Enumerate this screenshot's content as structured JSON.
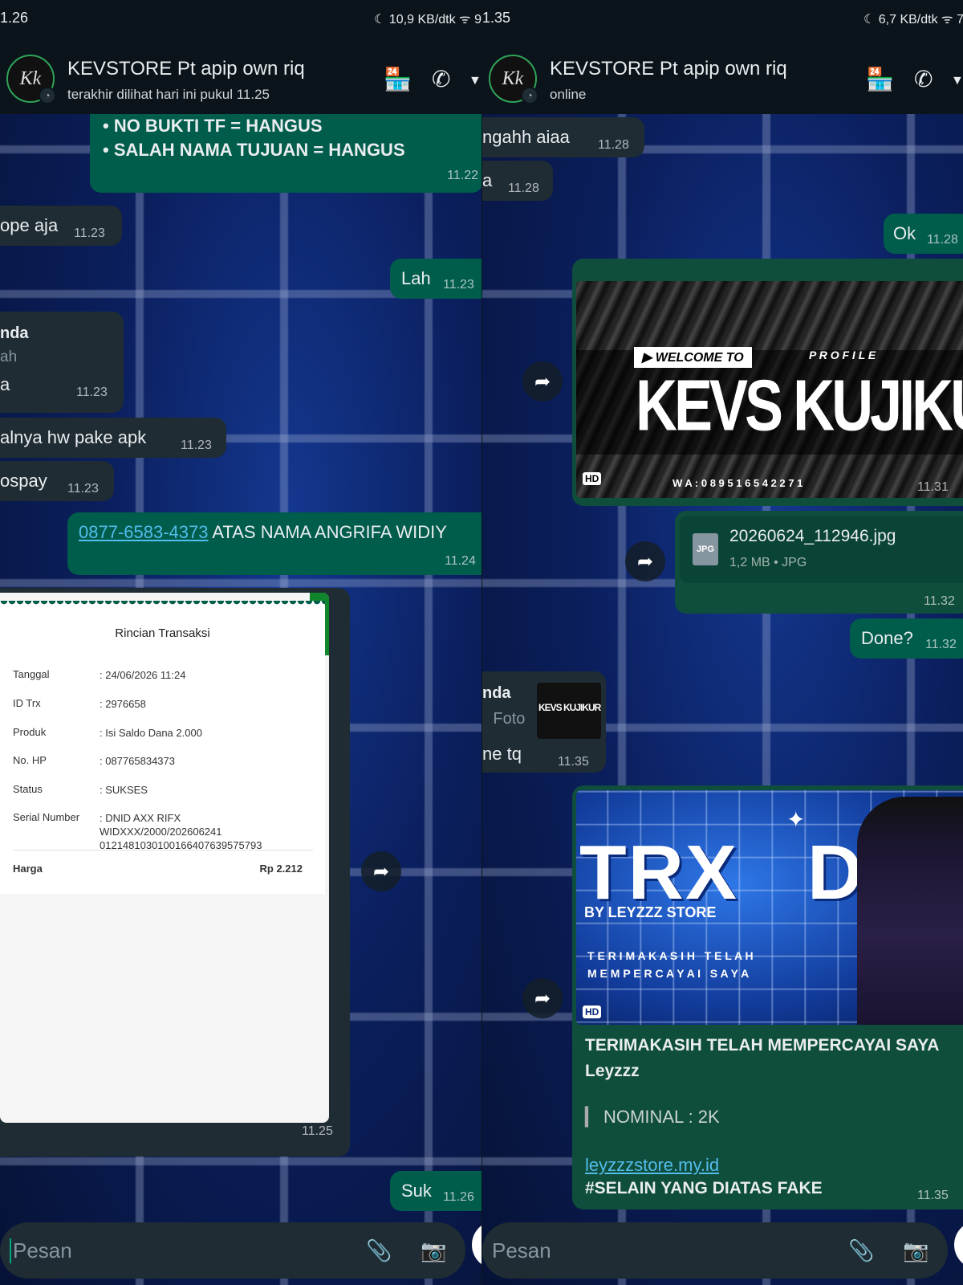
{
  "left": {
    "status_time": "1.26",
    "status_icons": "☾ 10,9 KB/dtk ᯤ 9",
    "contact_name": "KEVSTORE Pt apip own riq",
    "contact_sub": "terakhir dilihat hari ini pukul 11.25",
    "msg_rules_1": "• NO BUKTI TF = HANGUS",
    "msg_rules_2": "• SALAH NAMA TUJUAN = HANGUS",
    "msg_rules_ts": "11.22",
    "msg_in1_text": "ope aja",
    "msg_in1_ts": "11.23",
    "msg_out_lah": "Lah",
    "msg_out_lah_ts": "11.23",
    "msg_in2_line1": "nda",
    "msg_in2_line2": "ah",
    "msg_in2_line3": "a",
    "msg_in2_ts": "11.23",
    "msg_in3_text": "alnya hw pake apk",
    "msg_in3_ts": "11.23",
    "msg_in4_text": "ospay",
    "msg_in4_ts": "11.23",
    "msg_out_phone_link": "0877-6583-4373",
    "msg_out_phone_rest": " ATAS NAMA ANGRIFA WIDIY",
    "msg_out_phone_ts": "11.24",
    "receipt": {
      "title": "Rincian Transaksi",
      "rows": [
        {
          "label": "Tanggal",
          "value": ": 24/06/2026 11:24"
        },
        {
          "label": "ID Trx",
          "value": ": 2976658"
        },
        {
          "label": "Produk",
          "value": ": Isi Saldo Dana 2.000"
        },
        {
          "label": "No. HP",
          "value": ": 087765834373"
        },
        {
          "label": "Status",
          "value": ": SUKSES"
        },
        {
          "label": "Serial Number",
          "value": ": DNID AXX RIFX WIDXXX/2000/202606241 0121481030100166407639575793"
        }
      ],
      "price_label": "Harga",
      "price_value": "Rp 2.212"
    },
    "msg_receipt_ts": "11.25",
    "msg_out_suk": "Suk",
    "msg_out_suk_ts": "11.26",
    "input_placeholder": "Pesan"
  },
  "right": {
    "status_time": "1.35",
    "status_icons": "☾ 6,7 KB/dtk ᯤ 7",
    "contact_name": "KEVSTORE Pt apip own riq",
    "contact_sub": "online",
    "msg_in1_text": "ngahh aiaa",
    "msg_in1_ts": "11.28",
    "msg_in2_text": "a",
    "msg_in2_ts": "11.28",
    "msg_out_ok": "Ok",
    "msg_out_ok_ts": "11.28",
    "kevs_image": {
      "welcome": "▶ WELCOME TO",
      "profile": "P R O F I L E",
      "title": "KEVS KUJIKURO",
      "wa": "W A : 0 8 9 5 1 6 5 4 2 2 7 1",
      "hd": "HD"
    },
    "msg_kevs_ts": "11.31",
    "file_name": "20260624_112946.jpg",
    "file_meta": "1,2 MB • JPG",
    "file_badge": "JPG",
    "msg_file_ts": "11.32",
    "msg_out_done": "Done?",
    "msg_out_done_ts": "11.32",
    "msg_in3_line1": "nda",
    "msg_in3_line2": "Foto",
    "msg_in3_line3": "ne tq",
    "msg_in3_ts": "11.35",
    "trx_image": {
      "big": "TRX   DON",
      "by": "BY LEYZZZ STORE",
      "line1": "T E R I M A K A S I H   T E L A H",
      "line2": "M E M P E R C A Y A I   S A Y A",
      "hd": "HD"
    },
    "trx_caption_1": "TERIMAKASIH TELAH MEMPERCAYAI SAYA",
    "trx_caption_2": "Leyzzz",
    "trx_nominal": "NOMINAL : 2K",
    "trx_link": "leyzzzstore.my.id",
    "trx_fake": "#SELAIN YANG DIATAS FAKE",
    "msg_trx_ts": "11.35",
    "input_placeholder": "Pesan"
  },
  "icons": {
    "store": "store-icon",
    "call": "phone-icon",
    "menu": "dropdown-icon",
    "forward": "forward-icon",
    "attach": "paperclip-icon",
    "camera": "camera-icon"
  }
}
